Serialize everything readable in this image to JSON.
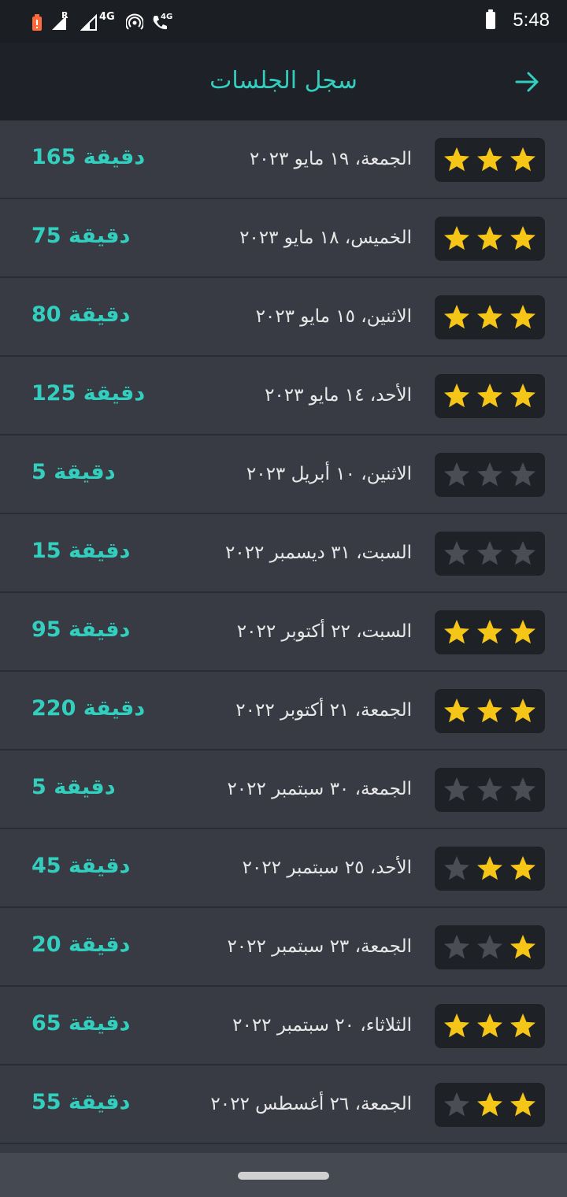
{
  "status_bar": {
    "time": "5:48",
    "icons": [
      "sim-alert-icon",
      "signal-roaming-icon",
      "signal-icon",
      "hotspot-icon",
      "wifi-calling-icon",
      "battery-icon"
    ],
    "network_label": "4G",
    "roaming_label": "R",
    "call_label": "4G"
  },
  "header": {
    "title": "سجل الجلسات",
    "back_icon": "arrow-right-icon"
  },
  "colors": {
    "accent": "#33cfbe",
    "star_filled": "#f5c518",
    "star_empty": "#4a4d54",
    "row_bg": "#383b43",
    "header_bg": "#1e2228"
  },
  "sessions": [
    {
      "date": "الجمعة، ١٩ مايو ٢٠٢٣",
      "duration": "165 دقيقة",
      "stars": 3
    },
    {
      "date": "الخميس، ١٨ مايو ٢٠٢٣",
      "duration": "75 دقيقة",
      "stars": 3
    },
    {
      "date": "الاثنين، ١٥ مايو ٢٠٢٣",
      "duration": "80 دقيقة",
      "stars": 3
    },
    {
      "date": "الأحد، ١٤ مايو ٢٠٢٣",
      "duration": "125 دقيقة",
      "stars": 3
    },
    {
      "date": "الاثنين، ١٠ أبريل ٢٠٢٣",
      "duration": "5 دقيقة",
      "stars": 0
    },
    {
      "date": "السبت، ٣١ ديسمبر ٢٠٢٢",
      "duration": "15 دقيقة",
      "stars": 0
    },
    {
      "date": "السبت، ٢٢ أكتوبر ٢٠٢٢",
      "duration": "95 دقيقة",
      "stars": 3
    },
    {
      "date": "الجمعة، ٢١ أكتوبر ٢٠٢٢",
      "duration": "220 دقيقة",
      "stars": 3
    },
    {
      "date": "الجمعة، ٣٠ سبتمبر ٢٠٢٢",
      "duration": "5 دقيقة",
      "stars": 0
    },
    {
      "date": "الأحد، ٢٥ سبتمبر ٢٠٢٢",
      "duration": "45 دقيقة",
      "stars": 2
    },
    {
      "date": "الجمعة، ٢٣ سبتمبر ٢٠٢٢",
      "duration": "20 دقيقة",
      "stars": 1
    },
    {
      "date": "الثلاثاء، ٢٠ سبتمبر ٢٠٢٢",
      "duration": "65 دقيقة",
      "stars": 3
    },
    {
      "date": "الجمعة، ٢٦ أغسطس ٢٠٢٢",
      "duration": "55 دقيقة",
      "stars": 2
    }
  ]
}
